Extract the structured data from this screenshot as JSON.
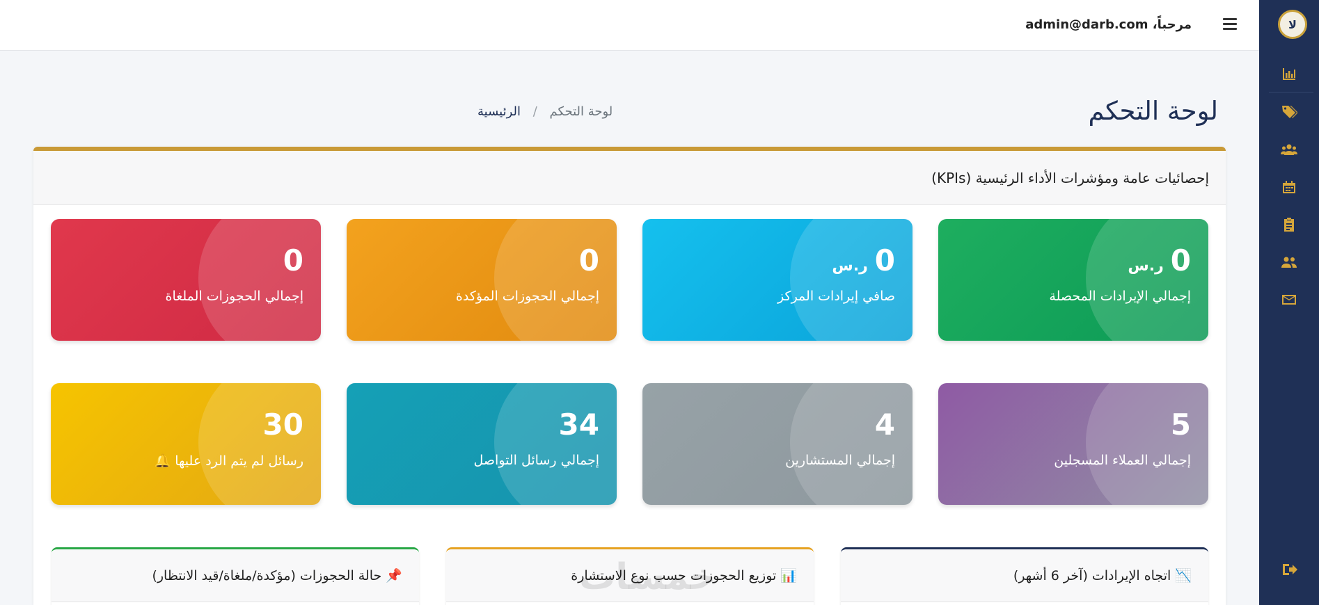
{
  "header": {
    "welcome": "مرحباً، admin@darb.com"
  },
  "sidebar": {
    "logo_text": "ﻻ",
    "items": [
      {
        "icon": "chart-bar-icon"
      },
      {
        "icon": "tags-icon"
      },
      {
        "icon": "users-icon"
      },
      {
        "icon": "calendar-icon"
      },
      {
        "icon": "clipboard-icon"
      },
      {
        "icon": "user-friends-icon"
      },
      {
        "icon": "envelope-icon"
      }
    ],
    "logout_icon": "sign-out-icon"
  },
  "page": {
    "title": "لوحة التحكم",
    "breadcrumb": {
      "home": "الرئيسية",
      "separator": "/",
      "current": "لوحة التحكم"
    }
  },
  "kpi": {
    "title": "إحصائيات عامة ومؤشرات الأداء الرئيسية (KPIs)",
    "cards": [
      {
        "value": "0",
        "unit": "ر.س",
        "label": "إجمالي الإيرادات المحصلة",
        "color": "#1eae5f"
      },
      {
        "value": "0",
        "unit": "ر.س",
        "label": "صافي إيرادات المركز",
        "color": "#15c0ee"
      },
      {
        "value": "0",
        "unit": "",
        "label": "إجمالي الحجوزات المؤكدة",
        "color": "#f3a21e"
      },
      {
        "value": "0",
        "unit": "",
        "label": "إجمالي الحجوزات الملغاة",
        "color": "#e0384c"
      },
      {
        "value": "5",
        "unit": "",
        "label": "إجمالي العملاء المسجلين",
        "color": "#8f5aa4"
      },
      {
        "value": "4",
        "unit": "",
        "label": "إجمالي المستشارين",
        "color": "#97a2a7"
      },
      {
        "value": "34",
        "unit": "",
        "label": "إجمالي رسائل التواصل",
        "color": "#15a0b6"
      },
      {
        "value": "30",
        "unit": "",
        "label": "رسائل لم يتم الرد عليها 🔔",
        "color": "#f6c400"
      }
    ]
  },
  "charts": {
    "revenue_trend": "📉 اتجاه الإيرادات (آخر 6 أشهر)",
    "bookings_by_type": "📊 توزيع الحجوزات حسب نوع الاستشارة",
    "booking_status": "📌 حالة الحجوزات (مؤكدة/ملغاة/قيد الانتظار)"
  },
  "watermark": "خمسات"
}
